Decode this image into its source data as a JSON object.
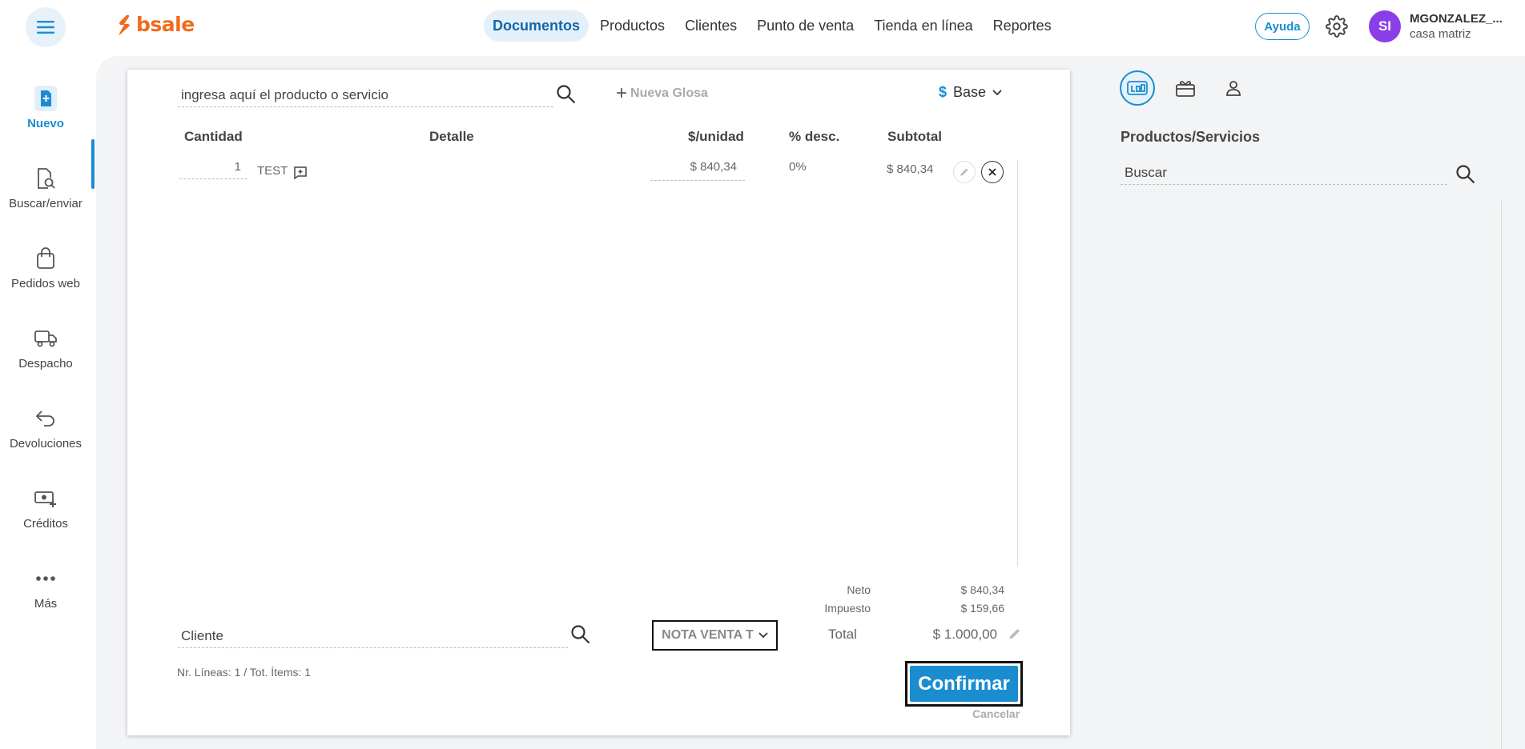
{
  "header": {
    "logo_text": "bsale",
    "nav": [
      "Documentos",
      "Productos",
      "Clientes",
      "Punto de venta",
      "Tienda en línea",
      "Reportes"
    ],
    "active_nav": "Documentos",
    "help_label": "Ayuda",
    "user": {
      "initials": "SI",
      "name": "MGONZALEZ_...",
      "branch": "casa matriz"
    }
  },
  "sidebar": {
    "items": [
      {
        "label": "Nuevo",
        "icon": "new-document-icon",
        "active": true
      },
      {
        "label": "Buscar/enviar",
        "icon": "search-document-icon",
        "active": false
      },
      {
        "label": "Pedidos web",
        "icon": "shopping-bag-icon",
        "active": false
      },
      {
        "label": "Despacho",
        "icon": "truck-icon",
        "active": false
      },
      {
        "label": "Devoluciones",
        "icon": "return-arrow-icon",
        "active": false
      },
      {
        "label": "Créditos",
        "icon": "credit-money-icon",
        "active": false
      },
      {
        "label": "Más",
        "icon": "more-dots-icon",
        "active": false
      }
    ]
  },
  "document": {
    "product_search_placeholder": "ingresa aquí el producto o servicio",
    "new_gloss_label": "Nueva Glosa",
    "price_list": {
      "symbol": "$",
      "label": "Base"
    },
    "columns": {
      "quantity": "Cantidad",
      "detail": "Detalle",
      "unit_price": "$/unidad",
      "discount": "% desc.",
      "subtotal": "Subtotal"
    },
    "lines": [
      {
        "quantity": "1",
        "detail": "TEST",
        "unit_price": "$ 840,34",
        "discount": "0%",
        "subtotal": "$ 840,34"
      }
    ],
    "totals": {
      "net_label": "Neto",
      "net_value": "$ 840,34",
      "tax_label": "Impuesto",
      "tax_value": "$ 159,66",
      "total_label": "Total",
      "total_value": "$ 1.000,00"
    },
    "client_placeholder": "Cliente",
    "doc_type": "NOTA VENTA T",
    "summary": "Nr. Líneas: 1 / Tot. Ítems: 1",
    "confirm_label": "Confirmar",
    "cancel_label": "Cancelar"
  },
  "right_panel": {
    "tabs": [
      "products-tab-icon",
      "gift-card-icon",
      "customer-icon"
    ],
    "title": "Productos/Servicios",
    "search_placeholder": "Buscar"
  },
  "colors": {
    "brand_orange": "#f26a1b",
    "accent_blue": "#1a8dd1",
    "avatar_purple": "#8a3ee8"
  }
}
